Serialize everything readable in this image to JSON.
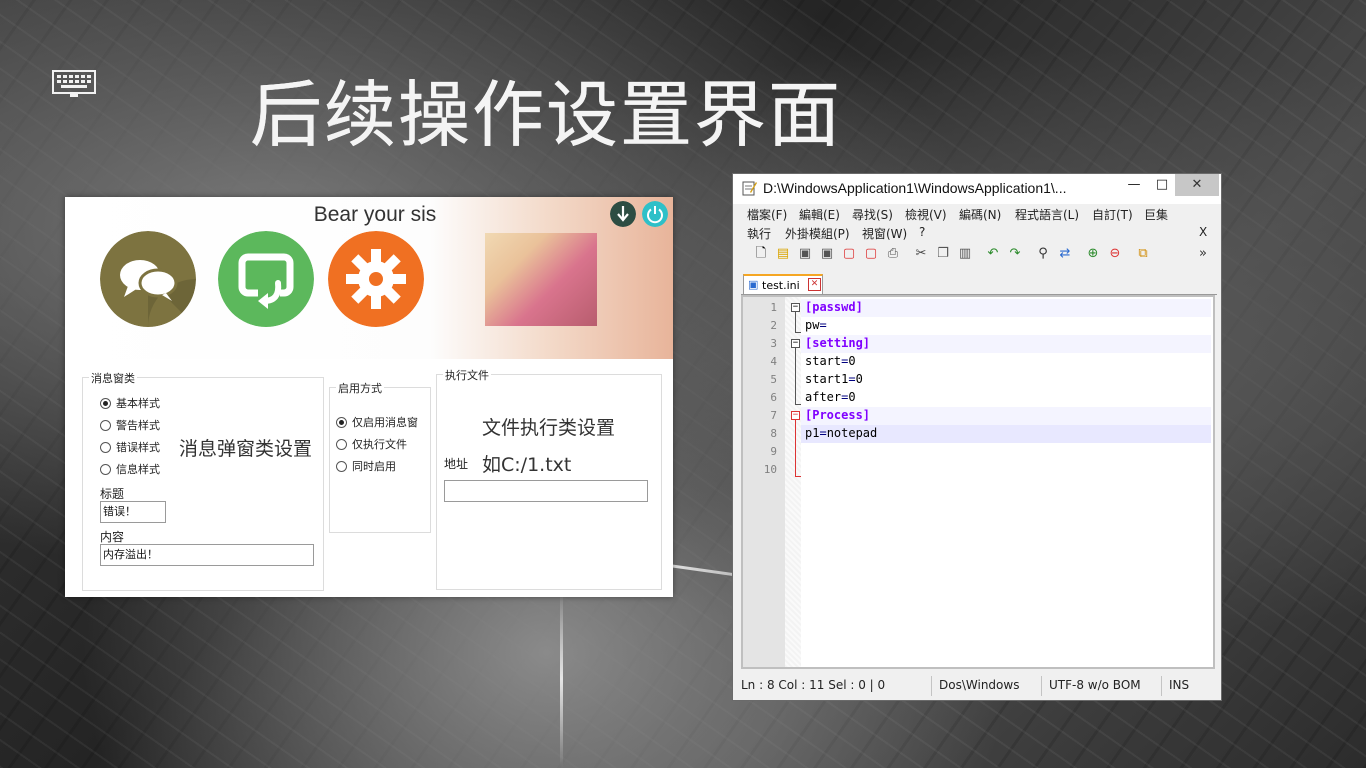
{
  "page": {
    "heading": "后续操作设置界面"
  },
  "app": {
    "title": "Bear your sis",
    "msg_section": {
      "legend": "消息窗类",
      "radios": [
        "基本样式",
        "警告样式",
        "错误样式",
        "信息样式"
      ],
      "selected": 0,
      "big_label": "消息弹窗类设置",
      "title_label": "标题",
      "title_value": "错误！",
      "content_label": "内容",
      "content_value": "内存溢出！"
    },
    "enable_section": {
      "legend": "启用方式",
      "radios": [
        "仅启用消息窗",
        "仅执行文件",
        "同时启用"
      ],
      "selected": 0
    },
    "exec_section": {
      "legend": "执行文件",
      "big_label": "文件执行类设置",
      "address_label": "地址",
      "address_hint": "如C:/1.txt",
      "address_value": ""
    }
  },
  "npp": {
    "title": "D:\\WindowsApplication1\\WindowsApplication1\\...",
    "menu_row1": [
      "檔案(F)",
      "編輯(E)",
      "尋找(S)",
      "檢視(V)",
      "編碼(N)",
      "程式語言(L)",
      "自訂(T)",
      "巨集"
    ],
    "menu_row2": [
      "執行",
      "外掛模組(P)",
      "視窗(W)",
      "?"
    ],
    "close_doc": "X",
    "tab": "test.ini",
    "lines": [
      {
        "n": "1",
        "text": "[passwd]",
        "section": true
      },
      {
        "n": "2",
        "text": "pw=",
        "section": false
      },
      {
        "n": "3",
        "text": "[setting]",
        "section": true
      },
      {
        "n": "4",
        "text": "start=0",
        "section": false
      },
      {
        "n": "5",
        "text": "start1=0",
        "section": false
      },
      {
        "n": "6",
        "text": "after=0",
        "section": false
      },
      {
        "n": "7",
        "text": "[Process]",
        "section": true
      },
      {
        "n": "8",
        "text": "p1=notepad",
        "section": false
      },
      {
        "n": "9",
        "text": "",
        "section": false
      },
      {
        "n": "10",
        "text": "",
        "section": false
      }
    ],
    "status": {
      "pos": "Ln : 8    Col : 11    Sel : 0 | 0",
      "eol": "Dos\\Windows",
      "encoding": "UTF-8 w/o BOM",
      "mode": "INS"
    },
    "colors": {
      "section": "#8000ff",
      "key": "#000000",
      "op": "#000080"
    }
  }
}
